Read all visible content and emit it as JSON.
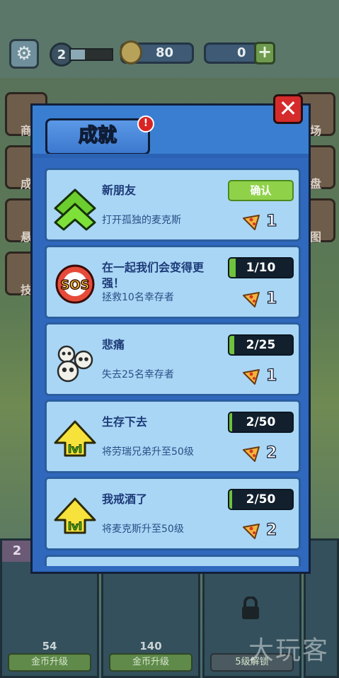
{
  "topbar": {
    "player_level": "2",
    "coins": "80",
    "pizza": "0",
    "plus_label": "+"
  },
  "side_buttons": {
    "shop_fragment": "商",
    "achieve_fragment": "成",
    "reward_fragment": "悬",
    "skill_fragment": "技",
    "right_fragments": [
      "场",
      "盘",
      "图"
    ]
  },
  "dialog": {
    "title": "成就",
    "badge_count": "!",
    "close_label": "✕",
    "items": [
      {
        "title": "新朋友",
        "desc": "打开孤独的麦克斯",
        "action_type": "confirm",
        "action_label": "确认",
        "reward": "1",
        "icon": "double-chevron-up-icon"
      },
      {
        "title": "在一起我们会变得更强！",
        "desc": "拯救10名幸存者",
        "action_type": "progress",
        "progress": "1/10",
        "progress_fraction": 0.1,
        "reward": "1",
        "icon": "sos-icon"
      },
      {
        "title": "悲痛",
        "desc": "失去25名幸存者",
        "action_type": "progress",
        "progress": "2/25",
        "progress_fraction": 0.08,
        "reward": "1",
        "icon": "skulls-icon"
      },
      {
        "title": "生存下去",
        "desc": "将劳瑞兄弟升至50级",
        "action_type": "progress",
        "progress": "2/50",
        "progress_fraction": 0.04,
        "reward": "2",
        "icon": "lvl-up-icon"
      },
      {
        "title": "我戒酒了",
        "desc": "将麦克斯升至50级",
        "action_type": "progress",
        "progress": "2/50",
        "progress_fraction": 0.04,
        "reward": "2",
        "icon": "lvl-up-icon"
      }
    ]
  },
  "bottom_cards": [
    {
      "num": "2",
      "price": "54",
      "upgrade_label": "金币升级"
    },
    {
      "num": "",
      "price": "140",
      "upgrade_label": "金币升级"
    },
    {
      "num": "",
      "price": "",
      "upgrade_label": "5级解锁"
    }
  ],
  "watermark": "大玩客",
  "colors": {
    "dialog_bg": "#2f68bd",
    "item_bg": "#a9d6f5",
    "confirm_green": "#8fd24a",
    "progress_green": "#6fc23c",
    "close_red": "#d62b2b"
  }
}
